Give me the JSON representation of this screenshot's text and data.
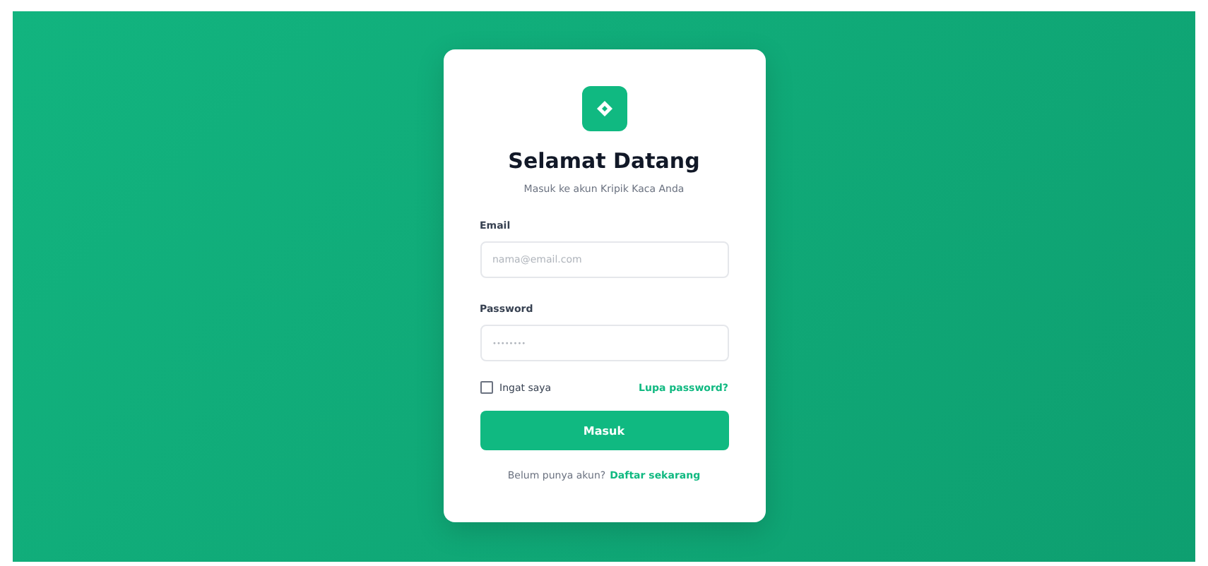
{
  "card": {
    "title": "Selamat Datang",
    "subtitle": "Masuk ke akun Kripik Kaca Anda"
  },
  "fields": [
    {
      "label": "Email",
      "placeholder": "nama@email.com",
      "kind": "text"
    },
    {
      "label": "Password",
      "placeholder": "••••••••",
      "kind": "secret"
    }
  ],
  "remember": {
    "label": "Ingat saya",
    "checked": false
  },
  "forgot_link": "Lupa password?",
  "submit": "Masuk",
  "signup": {
    "prompt": "Belum punya akun?",
    "link": "Daftar sekarang"
  }
}
